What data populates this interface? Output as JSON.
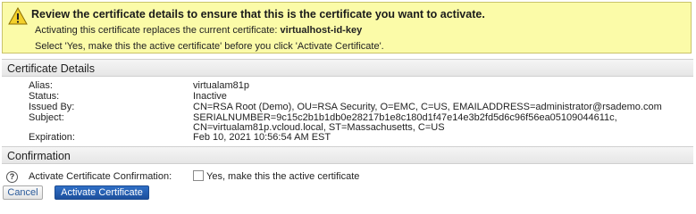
{
  "warning": {
    "icon": "warning-icon",
    "title": "Review the certificate details to ensure that this is the certificate you want to activate.",
    "replace_text": "Activating this certificate replaces the current certificate:",
    "current_cert": "virtualhost-id-key",
    "instruction": "Select 'Yes, make this the active certificate' before you click 'Activate Certificate'."
  },
  "details": {
    "header": "Certificate Details",
    "alias_label": "Alias:",
    "alias": "virtualam81p",
    "status_label": "Status:",
    "status": "Inactive",
    "issued_by_label": "Issued By:",
    "issued_by": "CN=RSA Root (Demo), OU=RSA Security, O=EMC, C=US, EMAILADDRESS=administrator@rsademo.com",
    "subject_label": "Subject:",
    "subject_line1": "SERIALNUMBER=9c15c2b1b1db0e28217b1e8c180d1f47e14e3b2fd5d6c96f56ea05109044611c,",
    "subject_line2": "CN=virtualam81p.vcloud.local, ST=Massachusetts, C=US",
    "expiration_label": "Expiration:",
    "expiration": "Feb 10, 2021 10:56:54 AM EST"
  },
  "confirmation": {
    "header": "Confirmation",
    "help_icon": "help-icon",
    "label": "Activate Certificate Confirmation:",
    "checkbox_text": "Yes, make this the active certificate",
    "checked": false
  },
  "buttons": {
    "cancel": "Cancel",
    "activate": "Activate Certificate"
  },
  "colors": {
    "warning_bg": "#fbfba8",
    "primary_button": "#2a63b5",
    "link_text": "#2a5a9a"
  }
}
